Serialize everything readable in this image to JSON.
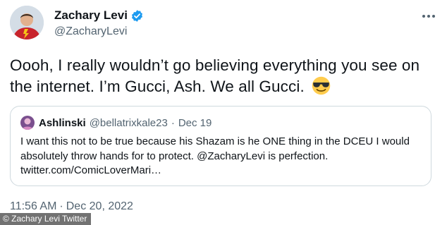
{
  "author": {
    "display_name": "Zachary Levi",
    "handle": "@ZacharyLevi",
    "verified": true,
    "avatar_icon": "avatar-shazam-costume"
  },
  "menu": {
    "icon": "more-options-icon"
  },
  "tweet": {
    "text": "Oooh, I really wouldn’t go believing everything you see on the internet. I’m Gucci, Ash. We all Gucci.",
    "emoji": "sunglasses-face"
  },
  "quoted_tweet": {
    "display_name": "Ashlinski",
    "handle": "@bellatrixkale23",
    "separator": "·",
    "date": "Dec 19",
    "text": "I want this not to be true because his Shazam is he ONE thing in the DCEU I would absolutely throw hands for to protect. @ZacharyLevi is perfection. twitter.com/ComicLoverMari…"
  },
  "timestamp": {
    "time": "11:56 AM",
    "separator": "·",
    "date": "Dec 20, 2022"
  },
  "credit": "© Zachary Levi Twitter",
  "colors": {
    "text": "#0f1419",
    "secondary": "#536471",
    "verified": "#1d9bf0",
    "border": "#cfd9de"
  }
}
